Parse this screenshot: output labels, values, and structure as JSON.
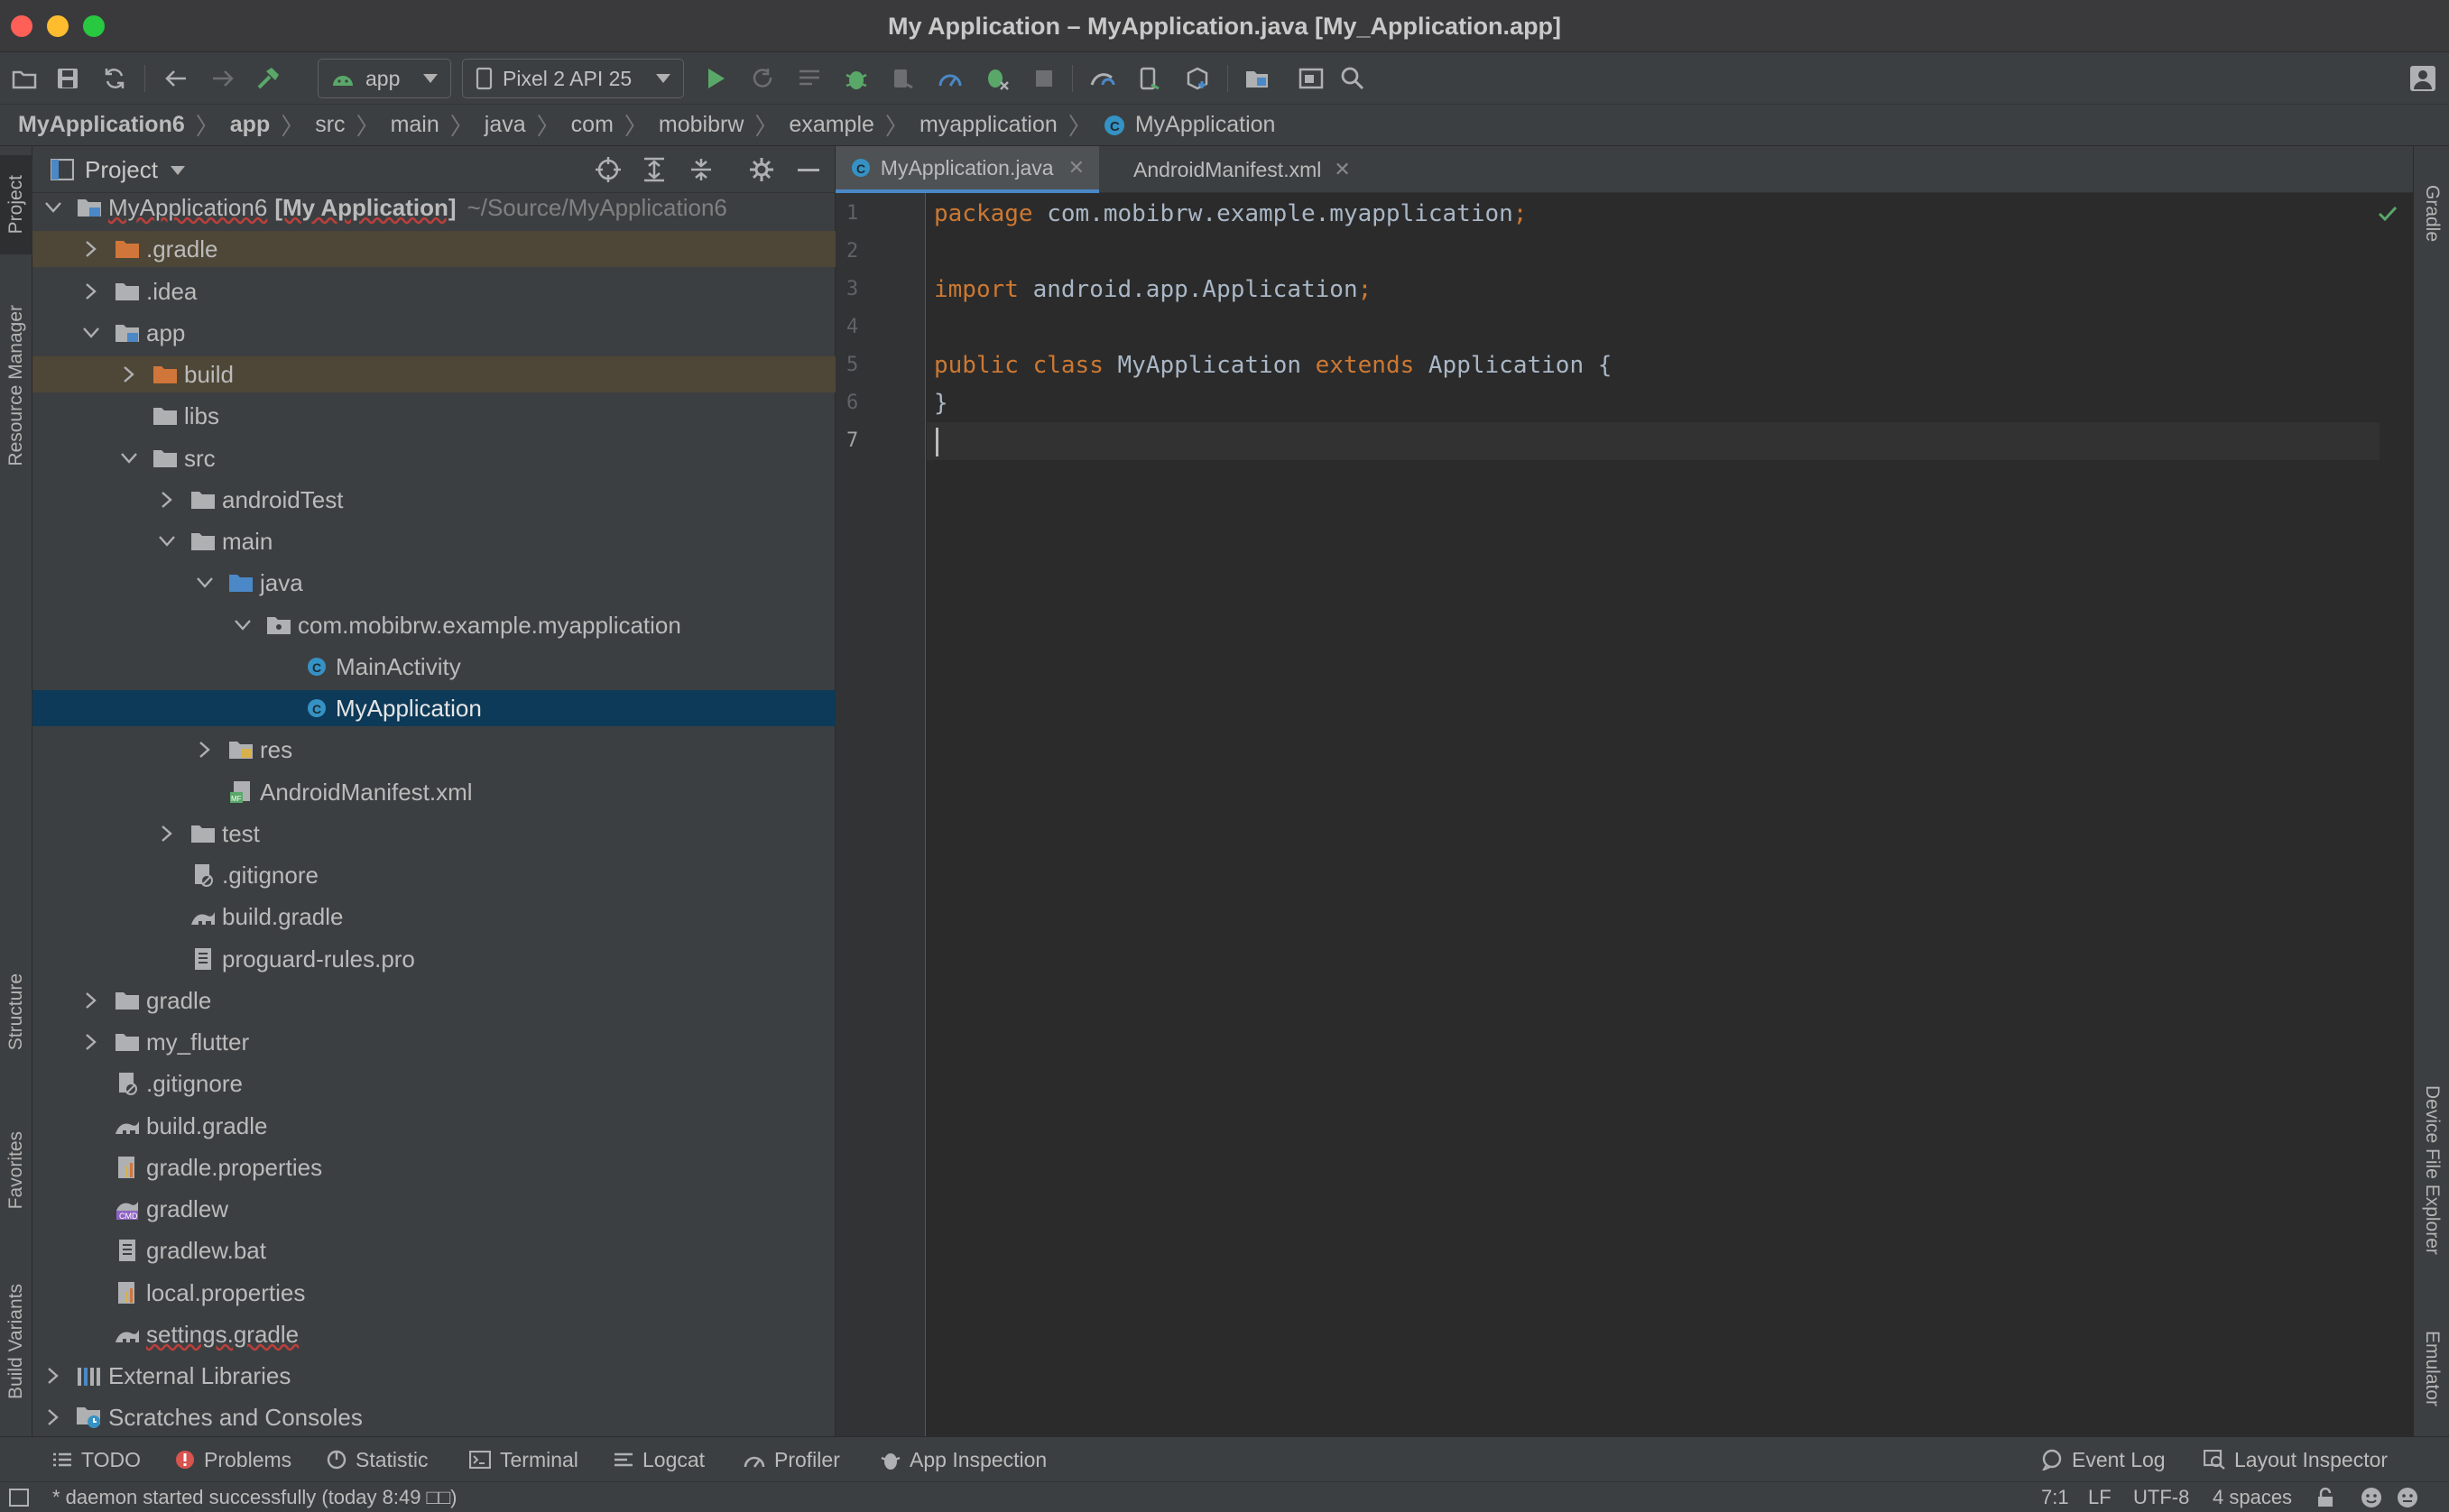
{
  "window": {
    "title": "My Application – MyApplication.java [My_Application.app]"
  },
  "toolbar": {
    "run_config": "app",
    "device": "Pixel 2 API 25"
  },
  "breadcrumb": [
    "MyApplication6",
    "app",
    "src",
    "main",
    "java",
    "com",
    "mobibrw",
    "example",
    "myapplication",
    "MyApplication"
  ],
  "left_tools": {
    "project": "Project",
    "resource_manager": "Resource Manager",
    "structure": "Structure",
    "favorites": "Favorites",
    "build_variants": "Build Variants"
  },
  "right_tools": {
    "gradle": "Gradle",
    "device_file_explorer": "Device File Explorer",
    "emulator": "Emulator"
  },
  "project_panel": {
    "view_name": "Project",
    "tree": [
      {
        "label": "MyApplication6",
        "label_bold": "[My Application]",
        "path": "~/Source/MyApplication6"
      },
      {
        "label": ".gradle"
      },
      {
        "label": ".idea"
      },
      {
        "label": "app"
      },
      {
        "label": "build"
      },
      {
        "label": "libs"
      },
      {
        "label": "src"
      },
      {
        "label": "androidTest"
      },
      {
        "label": "main"
      },
      {
        "label": "java"
      },
      {
        "label": "com.mobibrw.example.myapplication"
      },
      {
        "label": "MainActivity"
      },
      {
        "label": "MyApplication"
      },
      {
        "label": "res"
      },
      {
        "label": "AndroidManifest.xml"
      },
      {
        "label": "test"
      },
      {
        "label": ".gitignore"
      },
      {
        "label": "build.gradle"
      },
      {
        "label": "proguard-rules.pro"
      },
      {
        "label": "gradle"
      },
      {
        "label": "my_flutter"
      },
      {
        "label": ".gitignore"
      },
      {
        "label": "build.gradle"
      },
      {
        "label": "gradle.properties"
      },
      {
        "label": "gradlew"
      },
      {
        "label": "gradlew.bat"
      },
      {
        "label": "local.properties"
      },
      {
        "label": "settings.gradle"
      },
      {
        "label": "External Libraries"
      },
      {
        "label": "Scratches and Consoles"
      }
    ]
  },
  "editor": {
    "tabs": [
      {
        "label": "MyApplication.java"
      },
      {
        "label": "AndroidManifest.xml"
      }
    ],
    "line_numbers": [
      "1",
      "2",
      "3",
      "4",
      "5",
      "6",
      "7"
    ],
    "code": {
      "l1_kw": "package",
      "l1_rest": " com.mobibrw.example.myapplication",
      "l1_semi": ";",
      "l3_kw": "import",
      "l3_rest": " android.app.Application",
      "l3_semi": ";",
      "l5_kw1": "public",
      "l5_kw2": "class",
      "l5_name": "MyApplication",
      "l5_kw3": "extends",
      "l5_rest": "Application {",
      "l6": "}"
    }
  },
  "bottom_tabs": {
    "todo": "TODO",
    "problems": "Problems",
    "statistic": "Statistic",
    "terminal": "Terminal",
    "logcat": "Logcat",
    "profiler": "Profiler",
    "app_inspection": "App Inspection",
    "event_log": "Event Log",
    "layout_inspector": "Layout Inspector"
  },
  "status": {
    "message": "* daemon started successfully (today 8:49 □□)",
    "position": "7:1",
    "line_sep": "LF",
    "encoding": "UTF-8",
    "indent": "4 spaces"
  },
  "colors": {
    "keyword": "#cc7832",
    "identifier": "#a9b7c6",
    "selection": "#0d3a58",
    "excluded_folder_bg": "#4e4636",
    "run_green": "#59a869"
  }
}
